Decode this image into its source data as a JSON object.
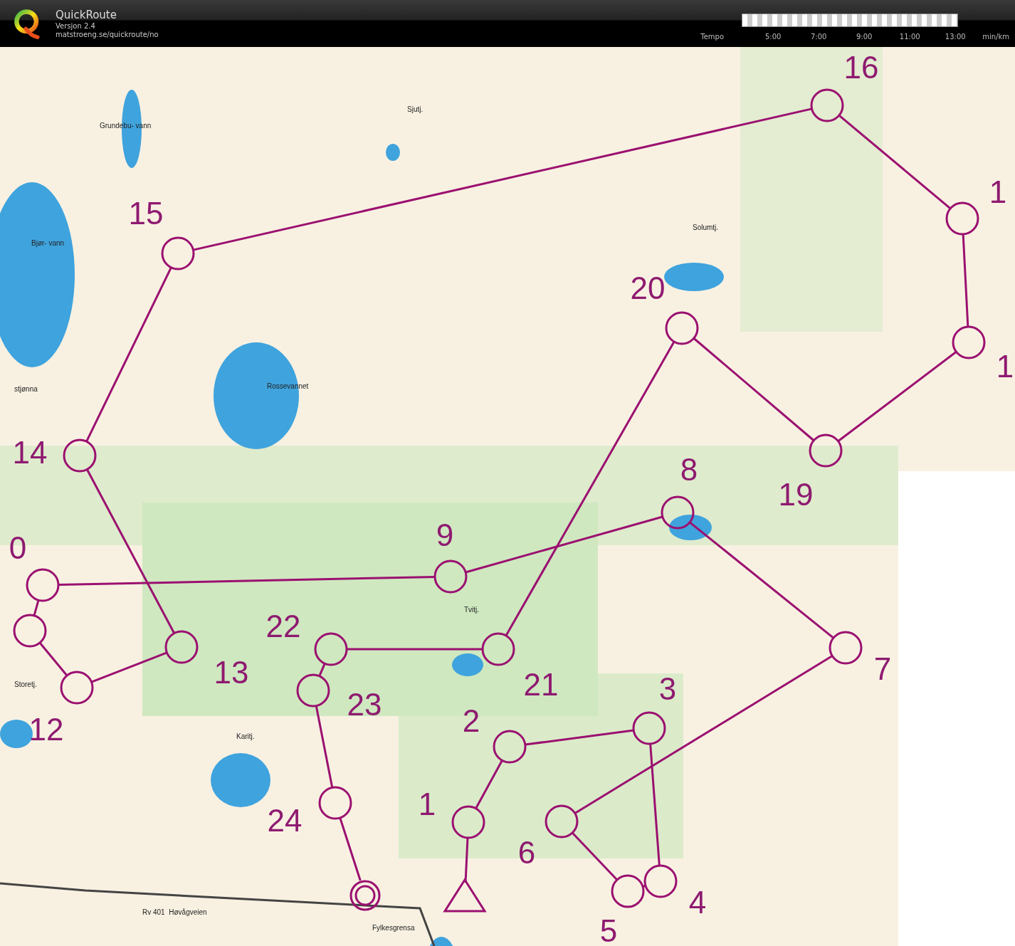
{
  "app": {
    "title": "QuickRoute",
    "version": "Versjon 2.4",
    "url": "matstroeng.se/quickroute/no"
  },
  "tempo_scale": {
    "label": "Tempo",
    "ticks": [
      "5:00",
      "7:00",
      "9:00",
      "11:00",
      "13:00"
    ],
    "unit": "min/km"
  },
  "map": {
    "labels": [
      "Grundebu-\nvann",
      "Bjør-\nvann",
      "stjønna",
      "Rossevannet",
      "Sjutj.",
      "Solumtj.",
      "Tvitj.",
      "Storetj.",
      "Karitj.",
      "Rv 401  Høvågveien",
      "Fylkesgrensa"
    ],
    "controls": [
      {
        "kind": "start"
      },
      {
        "kind": "control",
        "number": "1"
      },
      {
        "kind": "control",
        "number": "2"
      },
      {
        "kind": "control",
        "number": "3"
      },
      {
        "kind": "control",
        "number": "4"
      },
      {
        "kind": "control",
        "number": "5"
      },
      {
        "kind": "control",
        "number": "6"
      },
      {
        "kind": "control",
        "number": "7"
      },
      {
        "kind": "control",
        "number": "8"
      },
      {
        "kind": "control",
        "number": "9"
      },
      {
        "kind": "control",
        "number": "0"
      },
      {
        "kind": "control"
      },
      {
        "kind": "control",
        "number": "12"
      },
      {
        "kind": "control",
        "number": "13"
      },
      {
        "kind": "control",
        "number": "14"
      },
      {
        "kind": "control",
        "number": "15"
      },
      {
        "kind": "control",
        "number": "16"
      },
      {
        "kind": "control",
        "number": "1"
      },
      {
        "kind": "control",
        "number": "1"
      },
      {
        "kind": "control",
        "number": "19"
      },
      {
        "kind": "control",
        "number": "20"
      },
      {
        "kind": "control",
        "number": "21"
      },
      {
        "kind": "control",
        "number": "22"
      },
      {
        "kind": "control",
        "number": "23"
      },
      {
        "kind": "control",
        "number": "24"
      },
      {
        "kind": "finish"
      }
    ]
  }
}
